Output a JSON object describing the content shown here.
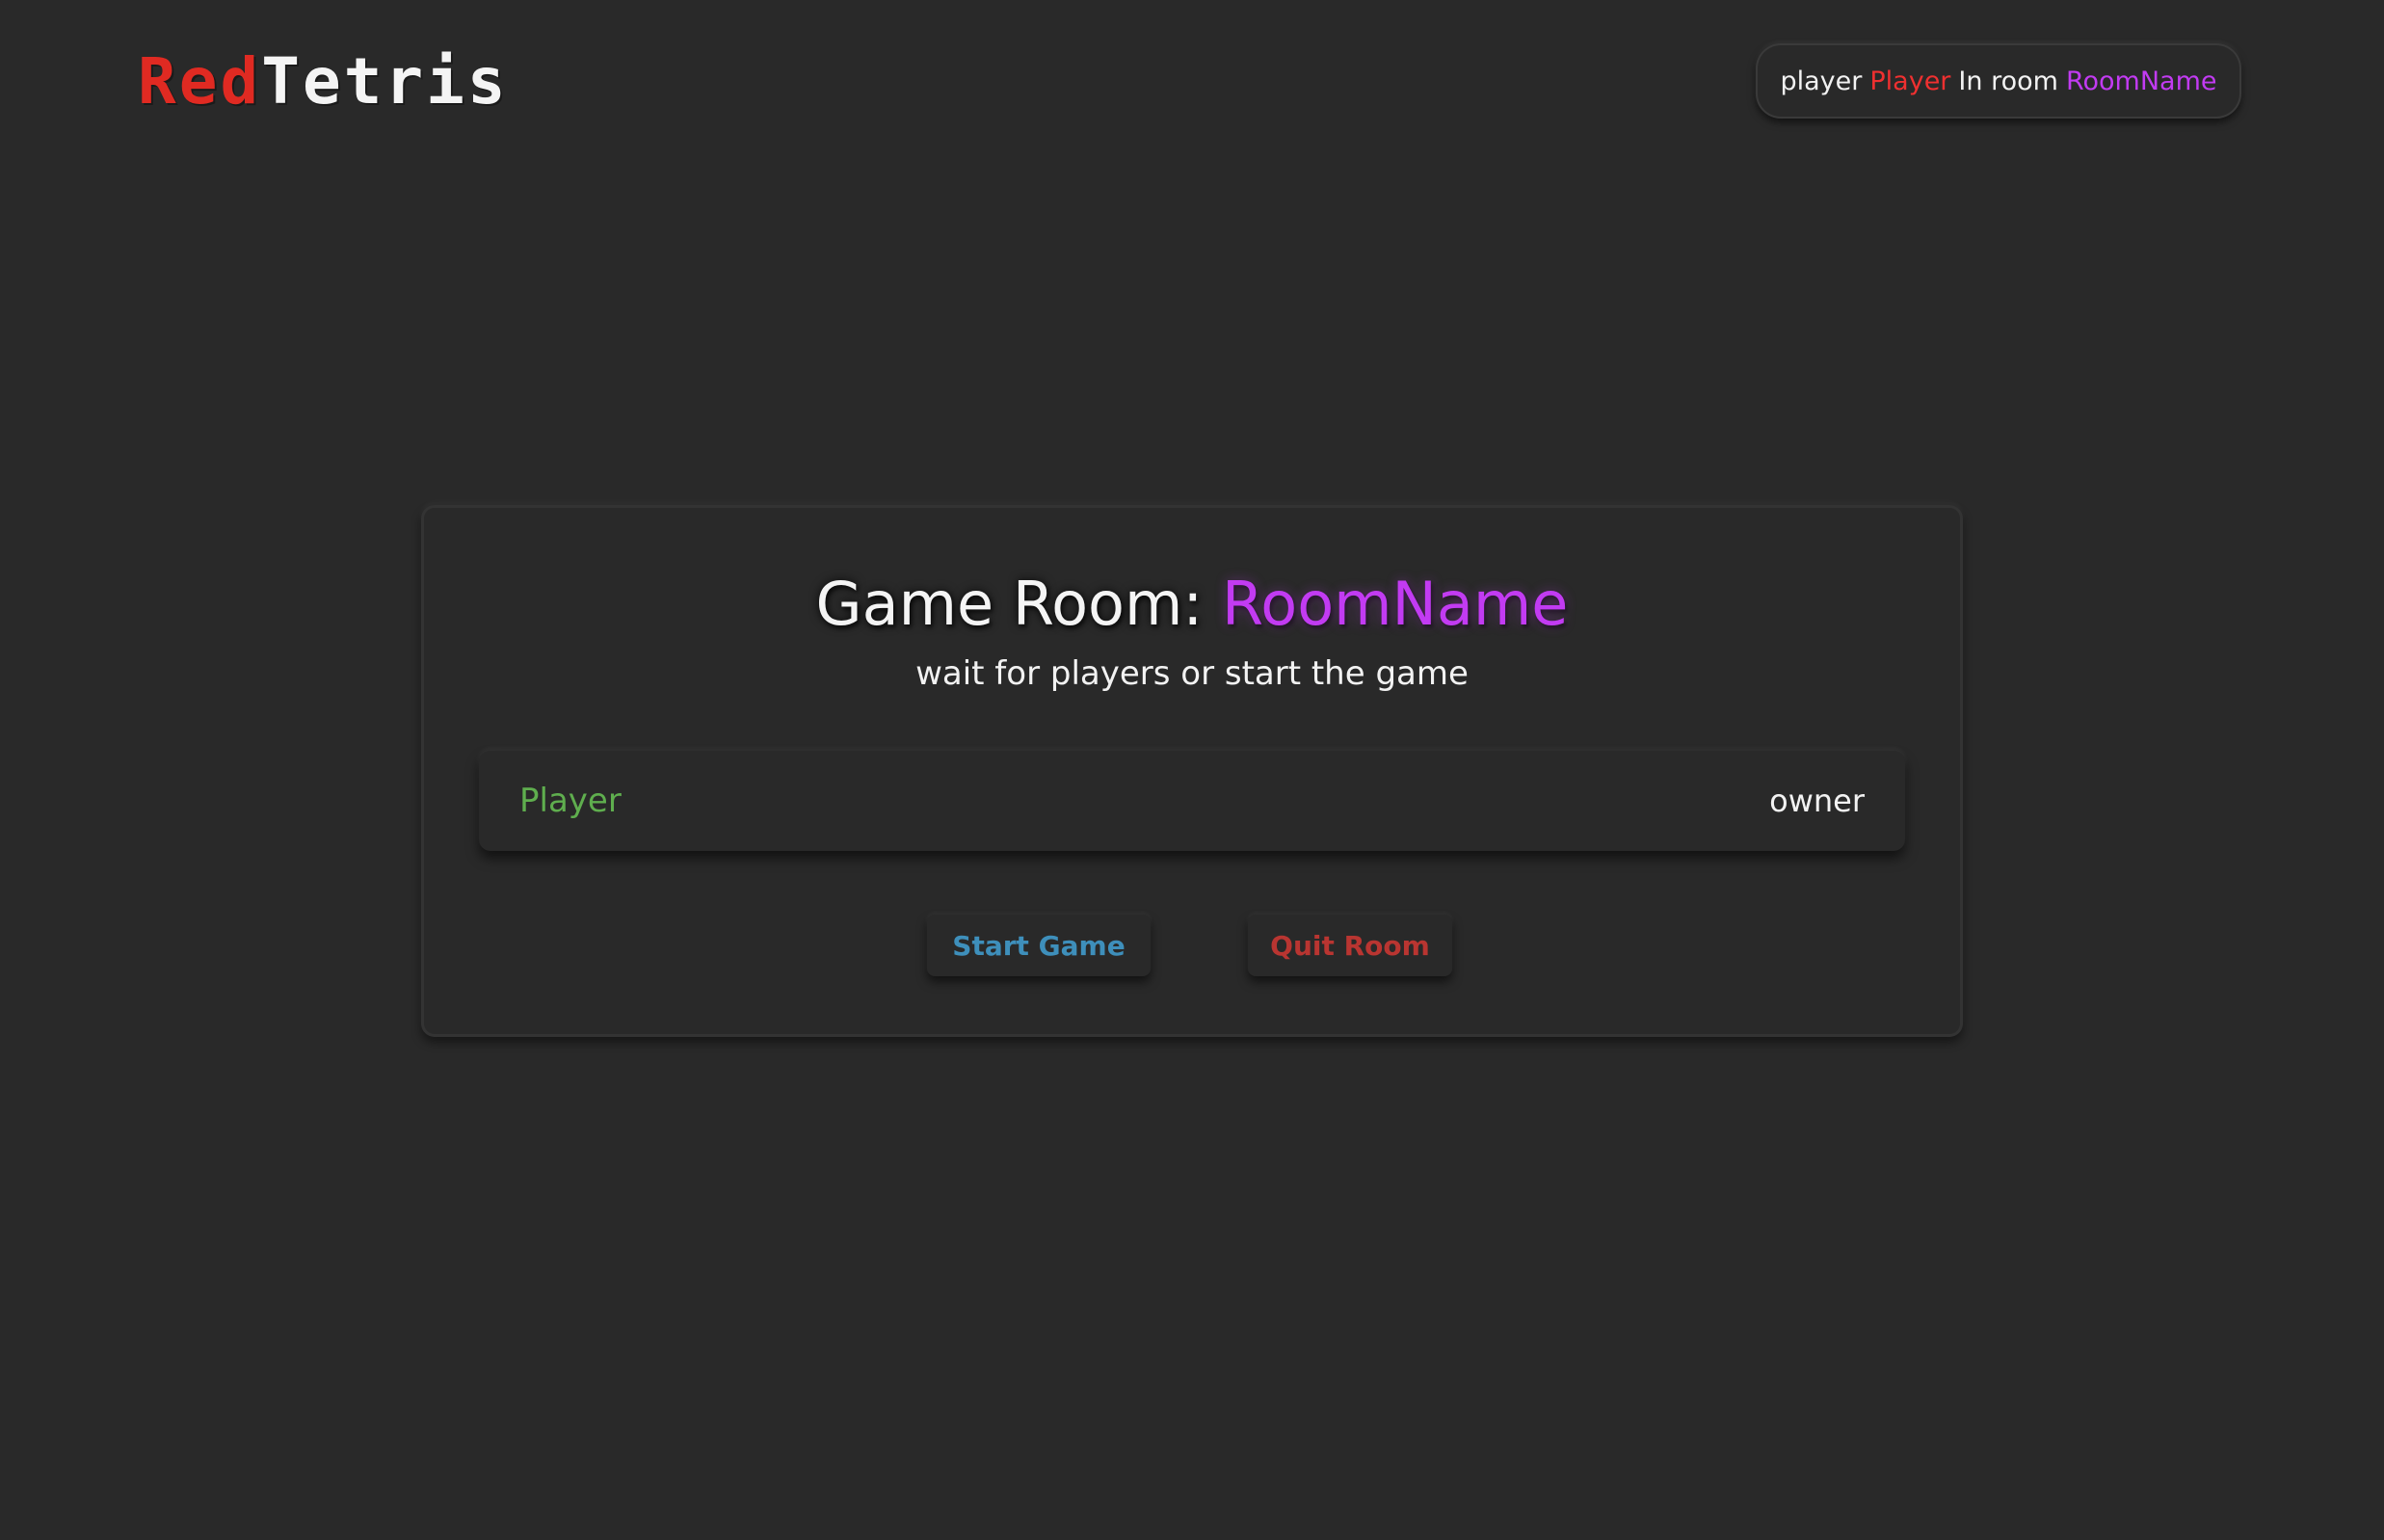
{
  "header": {
    "logo_part1": "Red",
    "logo_part2": "Tetris",
    "status": {
      "player_label": "player",
      "player_name": "Player",
      "room_label": "In room",
      "room_name": "RoomName"
    }
  },
  "room": {
    "title_prefix": "Game Room:",
    "room_name": "RoomName",
    "subtitle": "wait for players or start the game",
    "players": [
      {
        "name": "Player",
        "role": "owner"
      }
    ],
    "buttons": {
      "start": "Start Game",
      "quit": "Quit Room"
    }
  },
  "colors": {
    "background": "#292929",
    "logo_red": "#e02a22",
    "accent_red": "#ef3030",
    "accent_purple": "#c23bf2",
    "player_green": "#5fae4e",
    "start_blue": "#3e8fbb",
    "quit_red": "#b93531"
  }
}
